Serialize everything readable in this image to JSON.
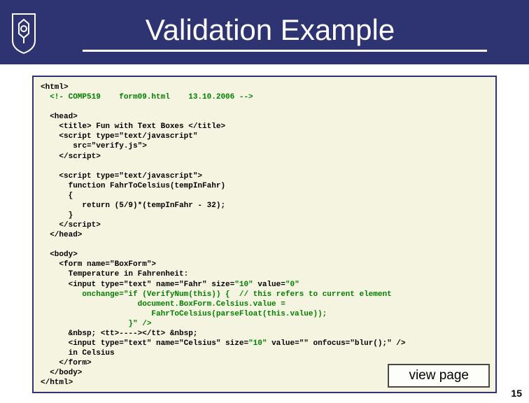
{
  "header": {
    "title": "Validation Example"
  },
  "code": {
    "l1": "<html>",
    "l2": "  <!- COMP519    form09.html    13.10.2006 -->",
    "l3": "  <head>",
    "l4": "    <title> Fun with Text Boxes </title>",
    "l5": "    <script type=\"text/javascript\"",
    "l6": "       src=\"verify.js\">",
    "l7": "    </script>",
    "l8": "    <script type=\"text/javascript\">",
    "l9": "      function FahrToCelsius(tempInFahr)",
    "l10": "      {",
    "l11": "         return (5/9)*(tempInFahr - 32);",
    "l12": "      }",
    "l13": "    </script>",
    "l14": "  </head>",
    "l15": "  <body>",
    "l16": "    <form name=\"BoxForm\">",
    "l17": "      Temperature in Fahrenheit:",
    "l18a": "      <input type=\"text\" name=\"Fahr\" size=",
    "l18b": "\"10\"",
    "l18c": " value=",
    "l18d": "\"0\"",
    "l19": "         onchange=\"if (VerifyNum(this)) {  // this refers to current element",
    "l20": "                     document.BoxForm.Celsius.value =",
    "l21": "                        FahrToCelsius(parseFloat(this.value));",
    "l22": "                   }\" />",
    "l23": "      &nbsp; <tt>----></tt> &nbsp;",
    "l24a": "      <input type=\"text\" name=\"Celsius\" size=",
    "l24b": "\"10\"",
    "l24c": " value=\"\" onfocus=\"blur();\" />",
    "l25": "      in Celsius",
    "l26": "    </form>",
    "l27": "  </body>",
    "l28": "</html>"
  },
  "button": {
    "view_label": "view page"
  },
  "page_number": "15"
}
